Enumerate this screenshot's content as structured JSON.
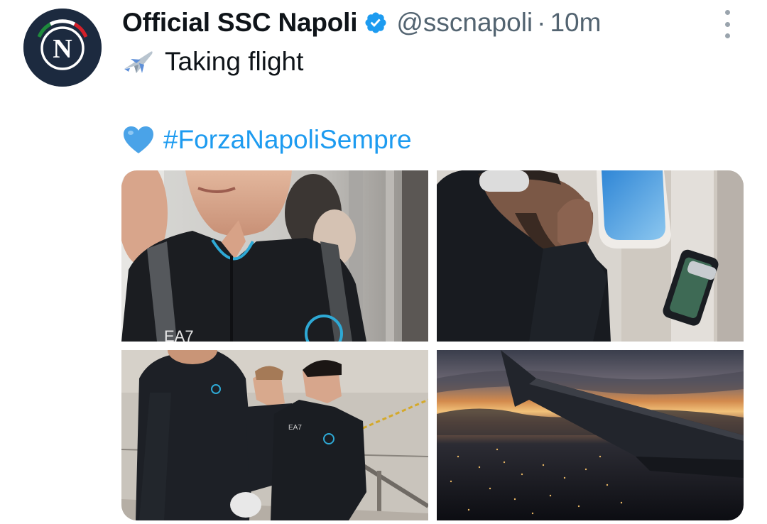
{
  "author": {
    "display_name": "Official SSC Napoli",
    "handle": "@sscnapoli",
    "separator": "·",
    "time": "10m",
    "avatar_letter": "N",
    "verified": true
  },
  "tweet": {
    "line1_text": "Taking flight",
    "line1_icon": "airplane-emoji",
    "line2_icon": "blue-heart-emoji",
    "hashtag": "#ForzaNapoliSempre"
  },
  "media": [
    {
      "name": "photo-player-with-backpack"
    },
    {
      "name": "photo-player-headphones-window"
    },
    {
      "name": "photo-players-boarding-stairs"
    },
    {
      "name": "photo-wing-sunset-city"
    }
  ],
  "colors": {
    "link": "#1d9bf0",
    "secondary_text": "#536471",
    "avatar_bg": "#1c2a3f",
    "napoli_blue": "#12a0d7"
  }
}
